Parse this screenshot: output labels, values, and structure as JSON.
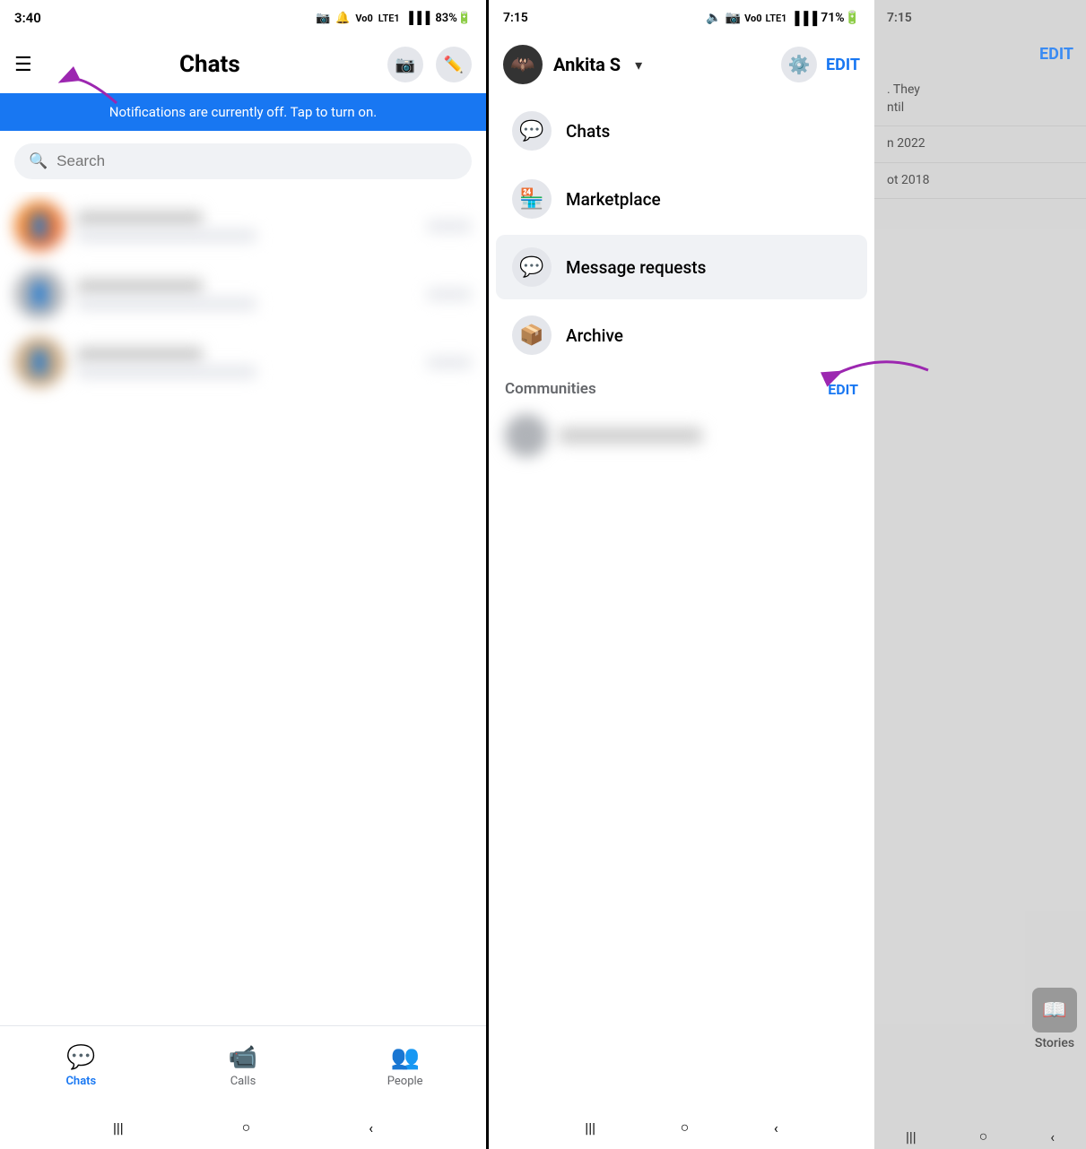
{
  "left": {
    "status": {
      "time": "3:40",
      "icons": "📷 📷 Vo0 LTE1 ▐▐▐ 83%🔋"
    },
    "title": "Chats",
    "notification": "Notifications are currently off. Tap to turn on.",
    "search_placeholder": "Search",
    "chats": [
      {
        "name": "Pa",
        "preview": "You",
        "time": "",
        "avatar_color": "orange",
        "blurred": true
      },
      {
        "name": "",
        "preview": "",
        "time": "",
        "avatar_color": "gray",
        "blurred": true
      },
      {
        "name": "",
        "preview": "",
        "time": "",
        "avatar_color": "tan",
        "blurred": true
      }
    ],
    "nav": {
      "items": [
        {
          "label": "Chats",
          "icon": "💬",
          "active": true
        },
        {
          "label": "Calls",
          "icon": "📹",
          "active": false
        },
        {
          "label": "People",
          "icon": "👥",
          "active": false
        }
      ]
    },
    "android_nav": [
      "|||",
      "○",
      "‹"
    ]
  },
  "right": {
    "sidebar": {
      "status": {
        "time": "7:15",
        "icons": "🔋 📷 Vo0 LTE1 ▐▐▐ 71%🔋"
      },
      "user": {
        "name": "Ankita S",
        "avatar_emoji": "🦇"
      },
      "edit_label": "EDIT",
      "nav_items": [
        {
          "label": "Chats",
          "icon": "💬",
          "active": false
        },
        {
          "label": "Marketplace",
          "icon": "🏪",
          "active": false
        },
        {
          "label": "Message requests",
          "icon": "💬",
          "active": true
        },
        {
          "label": "Archive",
          "icon": "📦",
          "active": false
        }
      ],
      "communities_label": "Communities",
      "communities_edit": "EDIT",
      "android_nav": [
        "|||",
        "○",
        "‹"
      ]
    },
    "overlay": {
      "chat1_line1": ". They",
      "chat1_line2": "ntil",
      "chat2": "n 2022",
      "chat3": "ot 2018",
      "stories_label": "Stories",
      "edit_label": "EDIT"
    }
  }
}
